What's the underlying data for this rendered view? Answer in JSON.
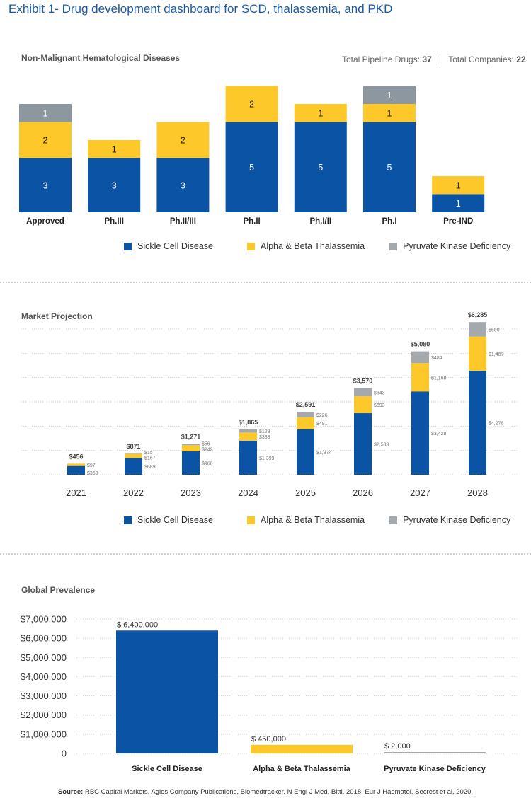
{
  "title": "Exhibit 1- Drug development dashboard for SCD, thalassemia, and PKD",
  "colors": {
    "scd": "#0b53a5",
    "thal": "#fdc82a",
    "pkd": "#a3a9ad",
    "pkd_pipeline": "#8c97a0",
    "title_blue": "#1a5aa6"
  },
  "legend": [
    "Sickle Cell Disease",
    "Alpha & Beta Thalassemia",
    "Pyruvate Kinase Deficiency"
  ],
  "pipeline_header": {
    "title": "Non-Malignant Hematological Diseases",
    "drugs_label": "Total Pipeline Drugs:",
    "drugs_value": "37",
    "companies_label": "Total Companies:",
    "companies_value": "22"
  },
  "market_header": {
    "title": "Market Projection"
  },
  "prevalence_header": {
    "title": "Global Prevalence"
  },
  "source": {
    "label": "Source:",
    "text": " RBC Capital Markets, Agios Company Publications, Biomedtracker, N Engl J Med, Bitti, 2018, Eur J Haematol, Secrest et al, 2020."
  },
  "chart_data": [
    {
      "type": "bar",
      "stacked": true,
      "title": "Non-Malignant Hematological Diseases",
      "categories": [
        "Approved",
        "Ph.III",
        "Ph.II/III",
        "Ph.II",
        "Ph.I/II",
        "Ph.I",
        "Pre-IND"
      ],
      "series": [
        {
          "name": "Sickle Cell Disease",
          "values": [
            3,
            3,
            3,
            5,
            5,
            5,
            1
          ]
        },
        {
          "name": "Alpha & Beta Thalassemia",
          "values": [
            2,
            1,
            2,
            2,
            1,
            1,
            1
          ]
        },
        {
          "name": "Pyruvate Kinase Deficiency",
          "values": [
            1,
            0,
            0,
            0,
            0,
            1,
            0
          ]
        }
      ],
      "legend": "bottom",
      "grid": false
    },
    {
      "type": "bar",
      "stacked": true,
      "title": "Market Projection",
      "categories": [
        "2021",
        "2022",
        "2023",
        "2024",
        "2025",
        "2026",
        "2027",
        "2028"
      ],
      "series": [
        {
          "name": "Sickle Cell Disease",
          "values": [
            359,
            689,
            966,
            1399,
            1874,
            2533,
            3428,
            4278
          ],
          "labels": [
            "$359",
            "$689",
            "$966",
            "$1,399",
            "$1,874",
            "$2,533",
            "$3,428",
            "$4,278"
          ]
        },
        {
          "name": "Alpha & Beta Thalassemia",
          "values": [
            97,
            167,
            249,
            338,
            491,
            693,
            1168,
            1407
          ],
          "labels": [
            "$97",
            "$167",
            "$249",
            "$338",
            "$491",
            "$693",
            "$1,168",
            "$1,407"
          ]
        },
        {
          "name": "Pyruvate Kinase Deficiency",
          "values": [
            0,
            15,
            56,
            128,
            226,
            343,
            484,
            600
          ],
          "labels": [
            "",
            "$15",
            "$56",
            "$128",
            "$226",
            "$343",
            "$484",
            "$600"
          ]
        }
      ],
      "totals": [
        "$456",
        "$871",
        "$1,271",
        "$1,865",
        "$2,591",
        "$3,570",
        "$5,080",
        "$6,285"
      ],
      "ylim": [
        0,
        6000
      ],
      "grid": true,
      "legend": "bottom"
    },
    {
      "type": "bar",
      "title": "Global Prevalence",
      "categories": [
        "Sickle Cell Disease",
        "Alpha & Beta Thalassemia",
        "Pyruvate Kinase Deficiency"
      ],
      "values": [
        6400000,
        450000,
        2000
      ],
      "data_labels": [
        "$ 6,400,000",
        "$ 450,000",
        "$ 2,000"
      ],
      "ylim": [
        0,
        7000000
      ],
      "yticks": [
        "0",
        "$1,000,000",
        "$2,000,000",
        "$3,000,000",
        "$4,000,000",
        "$5,000,000",
        "$6,000,000",
        "$7,000,000"
      ],
      "grid": true
    }
  ]
}
